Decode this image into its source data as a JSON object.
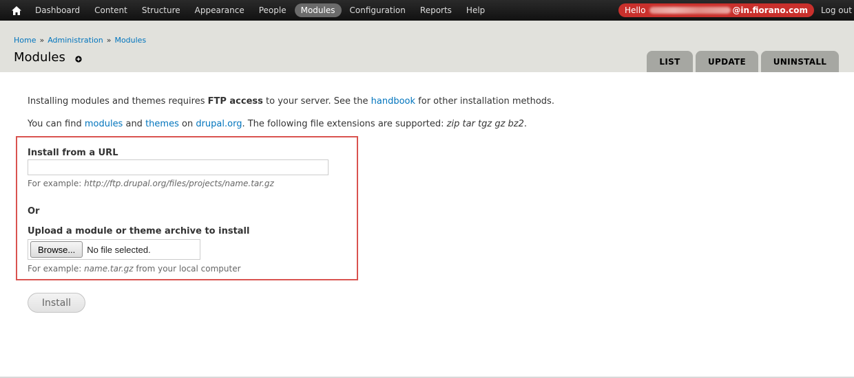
{
  "toolbar": {
    "home_icon": "home-icon",
    "menu": [
      {
        "label": "Dashboard"
      },
      {
        "label": "Content"
      },
      {
        "label": "Structure"
      },
      {
        "label": "Appearance"
      },
      {
        "label": "People"
      },
      {
        "label": "Modules",
        "active": true
      },
      {
        "label": "Configuration"
      },
      {
        "label": "Reports"
      },
      {
        "label": "Help"
      }
    ],
    "hello_prefix": "Hello",
    "user_domain": "@in.fiorano.com",
    "logout": "Log out"
  },
  "breadcrumb": [
    "Home",
    "Administration",
    "Modules"
  ],
  "breadcrumb_separator": "»",
  "page_title": "Modules",
  "shortcut_icon": "add-shortcut-icon",
  "tabs": [
    "LIST",
    "UPDATE",
    "UNINSTALL"
  ],
  "intro": {
    "p1_before": "Installing modules and themes requires ",
    "p1_bold": "FTP access",
    "p1_mid": " to your server. See the ",
    "p1_link": "handbook",
    "p1_after": " for other installation methods.",
    "p2_before": "You can find ",
    "p2_link1": "modules",
    "p2_and": " and ",
    "p2_link2": "themes",
    "p2_on": " on ",
    "p2_link3": "drupal.org",
    "p2_text": ". The following file extensions are supported: ",
    "p2_ext": "zip tar tgz gz bz2",
    "p2_end": "."
  },
  "form": {
    "url_label": "Install from a URL",
    "url_value": "",
    "url_help_prefix": "For example: ",
    "url_help_example": "http://ftp.drupal.org/files/projects/name.tar.gz",
    "or_label": "Or",
    "upload_label": "Upload a module or theme archive to install",
    "browse_label": "Browse...",
    "file_status": "No file selected.",
    "upload_help_prefix": "For example: ",
    "upload_help_example": "name.tar.gz",
    "upload_help_suffix": " from your local computer",
    "install_button": "Install"
  },
  "colors": {
    "toolbar_bg": "#1b1b1b",
    "hello_badge": "#c9302c",
    "header_bg": "#e1e1dc",
    "tab_bg": "#a6a7a2",
    "link": "#0074bd",
    "highlight_box": "#d9534f"
  }
}
